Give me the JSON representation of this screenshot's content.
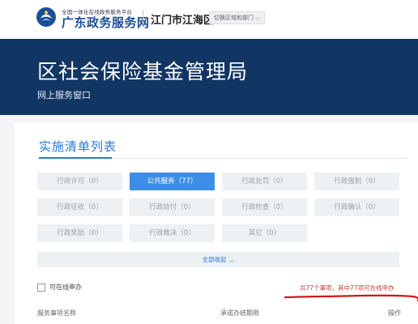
{
  "header": {
    "platform_subtitle": "全国一体化在线政务服务平台",
    "platform_name": "广东政务服务网",
    "region": "江门市江海区",
    "switch_label": "切换区域和部门",
    "switch_caret": "⌵",
    "logo_icon": "guangdong-government-logo-icon"
  },
  "banner": {
    "title": "区社会保险基金管理局",
    "subtitle": "网上服务窗口"
  },
  "section": {
    "title": "实施清单列表"
  },
  "categories": [
    {
      "label": "行政许可（0）",
      "active": false
    },
    {
      "label": "公共服务（77）",
      "active": true
    },
    {
      "label": "行政处罚（0）",
      "active": false
    },
    {
      "label": "行政强制（0）",
      "active": false
    },
    {
      "label": "行政征收（0）",
      "active": false
    },
    {
      "label": "行政给付（0）",
      "active": false
    },
    {
      "label": "行政检查（0）",
      "active": false
    },
    {
      "label": "行政确认（0）",
      "active": false
    },
    {
      "label": "行政奖励（0）",
      "active": false
    },
    {
      "label": "行政裁决（0）",
      "active": false
    },
    {
      "label": "其它（0）",
      "active": false
    }
  ],
  "collapse": {
    "label": "全部收起",
    "caret": "︿"
  },
  "filter": {
    "online_label": "可在线申办",
    "summary": "共77个事项，其中77项可在线申办"
  },
  "table": {
    "col_name": "服务事项名称",
    "col_time": "承诺办结期限",
    "col_action": "操作"
  },
  "colors": {
    "banner_bg": "#123663",
    "accent": "#2a78d5",
    "active_tag": "#3d8ee6",
    "annotation_red": "#d01818"
  }
}
